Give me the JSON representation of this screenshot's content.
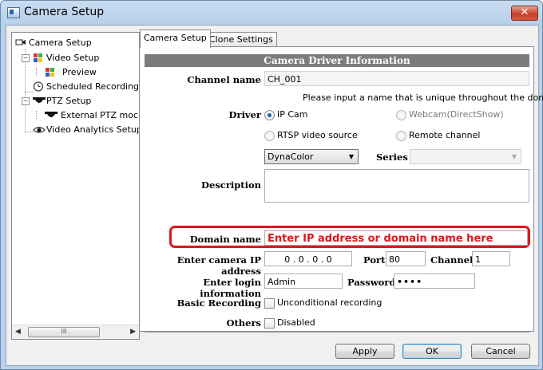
{
  "window": {
    "title": "Camera Setup",
    "close_icon": "close-icon"
  },
  "tree": {
    "items": [
      {
        "label": "Camera Setup",
        "icon": "camera-icon"
      },
      {
        "label": "Video Setup",
        "icon": "video-grid-icon"
      },
      {
        "label": "Preview",
        "icon": "preview-grid-icon"
      },
      {
        "label": "Scheduled Recording",
        "icon": "clock-icon"
      },
      {
        "label": "PTZ Setup",
        "icon": "dome-camera-icon"
      },
      {
        "label": "External PTZ moc",
        "icon": "dome-camera-icon"
      },
      {
        "label": "Video Analytics Setup",
        "icon": "eye-icon"
      }
    ],
    "scrollbar_thumb": "III"
  },
  "tabs": [
    {
      "label": "Camera Setup"
    },
    {
      "label": "Clone Settings"
    }
  ],
  "form": {
    "header": "Camera Driver Information",
    "channel_name_label": "Channel name",
    "channel_name_value": "CH_001",
    "hint": "Please input a name that is unique throughout the domain.",
    "driver_label": "Driver",
    "driver_options": {
      "ip_cam": "IP Cam",
      "webcam": "Webcam(DirectShow)",
      "rtsp": "RTSP video source",
      "remote": "Remote channel"
    },
    "driver_selected": "IP Cam",
    "brand_value": "DynaColor",
    "series_label": "Series",
    "series_value": "",
    "description_label": "Description",
    "description_value": "",
    "domain_name_label": "Domain name",
    "domain_name_hint": "Enter IP address or domain name here",
    "ip_label": "Enter camera IP address",
    "ip_value": "0 . 0 . 0 . 0",
    "port_label": "Port",
    "port_value": "80",
    "channel_label": "Channel",
    "channel_value": "1",
    "login_label": "Enter login information",
    "login_value": "Admin",
    "password_label": "Password",
    "password_value": "••••",
    "basic_recording_label": "Basic Recording",
    "basic_recording_option": "Unconditional recording",
    "basic_recording_checked": false,
    "others_label": "Others",
    "others_option": "Disabled",
    "others_checked": false
  },
  "buttons": {
    "apply": "Apply",
    "ok": "OK",
    "cancel": "Cancel"
  },
  "colors": {
    "highlight": "#e0151b",
    "header_bar": "#7c7c7c",
    "title_gradient": "#b8d0ea"
  }
}
